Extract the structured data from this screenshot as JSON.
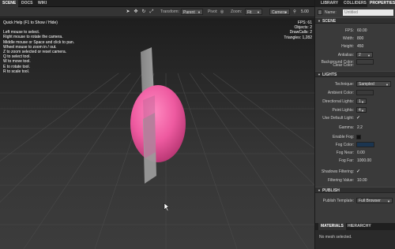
{
  "tabs": [
    {
      "label": "SCENE",
      "active": true
    },
    {
      "label": "DOCS",
      "active": false
    },
    {
      "label": "WIKI",
      "active": false
    }
  ],
  "toolbar": {
    "transform_label": "Transform:",
    "transform_value": "Parent",
    "pivot_label": "Pivot:",
    "zoom_label": "Zoom:",
    "zoom_value": "Fit",
    "camera_value": "Camera",
    "camera_number": "5.00",
    "tools": [
      "pointer-icon",
      "move-icon",
      "rotate-icon",
      "scale-icon"
    ]
  },
  "viewport": {
    "help_title": "Quick Help (F1 to Show / Hide)",
    "help_lines": [
      "Left mouse to select.",
      "Right mouse to rotate the camera.",
      "Middle mouse or Space and click to pan.",
      "Wheel mouse to zoom in / out.",
      "Z to zoom selected or reset camera.",
      "Q to select tool.",
      "W to move tool.",
      "E to rotate tool.",
      "R to scale tool."
    ],
    "stats": [
      "FPS: 61",
      "Objects: 2",
      "DrawCalls: 2",
      "Triangles: 1,282"
    ],
    "sphere_color": "#ee5aa0",
    "plane_color": "#a0a0a0"
  },
  "right_panel": {
    "tabs": [
      {
        "label": "LIBRARY",
        "active": false
      },
      {
        "label": "COLLIDERS",
        "active": false
      },
      {
        "label": "PROPERTIES",
        "active": true
      }
    ],
    "name_label": "Name:",
    "name_value": "Untitled",
    "scene_header": "SCENE",
    "fps_label": "FPS:",
    "fps_value": "60.00",
    "width_label": "Width:",
    "width_value": "800",
    "height_label": "Height:",
    "height_value": "450",
    "antialias_label": "Antialias:",
    "antialias_value": "2",
    "bgcolor_label": "Background Color:",
    "clearcolor_label": "Clear Color:",
    "lights_header": "LIGHTS",
    "technique_label": "Technique:",
    "technique_value": "Sampled",
    "ambient_label": "Ambient Color:",
    "dirlights_label": "Directional Lights:",
    "dirlights_value": "1",
    "pointlights_label": "Point Lights:",
    "pointlights_value": "4",
    "defaultlight_label": "Use Default Light:",
    "gamma_label": "Gamma:",
    "gamma_value": "2.2",
    "enablefog_label": "Enable Fog:",
    "fogcolor_label": "Fog Color:",
    "fognear_label": "Fog Near:",
    "fognear_value": "0.00",
    "fogfar_label": "Fog Far:",
    "fogfar_value": "1000.00",
    "shadowfilter_label": "Shadows Filtering:",
    "filtervalue_label": "Filtering Value:",
    "filtervalue_value": "10.00",
    "publish_header": "PUBLISH",
    "publishtemplate_label": "Publish Template:",
    "publishtemplate_value": "Full Browser",
    "bottom_tabs": [
      {
        "label": "MATERIALS",
        "active": true
      },
      {
        "label": "HIERARCHY",
        "active": false
      }
    ],
    "no_mesh": "No mesh selected.",
    "fog_color_swatch": "#1b3550"
  }
}
